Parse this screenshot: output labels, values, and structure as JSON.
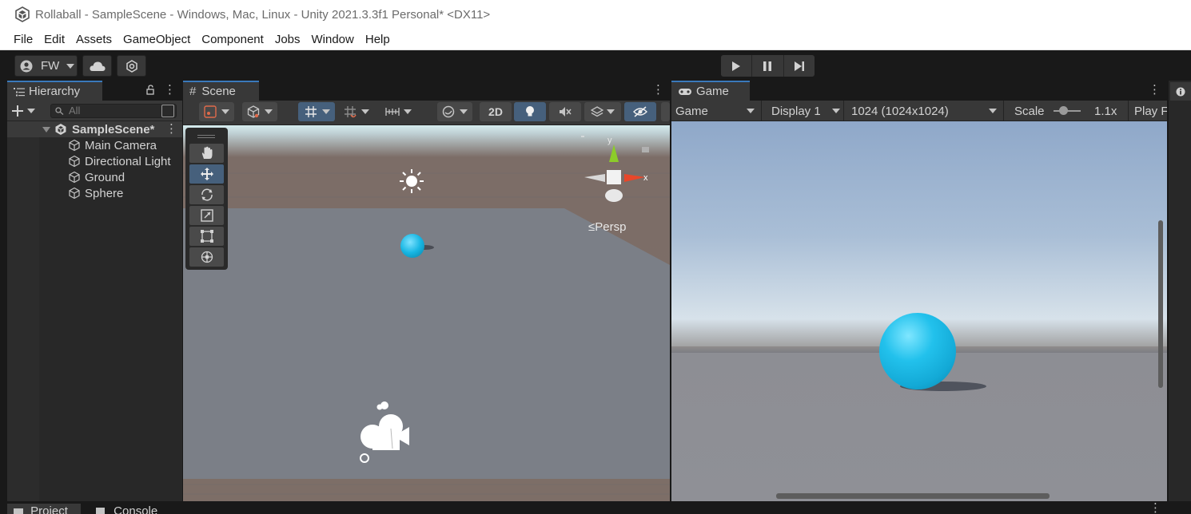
{
  "window": {
    "title": "Rollaball - SampleScene - Windows, Mac, Linux - Unity 2021.3.3f1 Personal* <DX11>"
  },
  "menu": [
    "File",
    "Edit",
    "Assets",
    "GameObject",
    "Component",
    "Jobs",
    "Window",
    "Help"
  ],
  "toolbar": {
    "account_label": "FW",
    "play_icon": "play-icon",
    "pause_icon": "pause-icon",
    "step_icon": "step-icon"
  },
  "hierarchy": {
    "tab_label": "Hierarchy",
    "search_placeholder": "All",
    "scene_name": "SampleScene*",
    "items": [
      "Main Camera",
      "Directional Light",
      "Ground",
      "Sphere"
    ]
  },
  "scene": {
    "tab_label": "Scene",
    "mode_2d_label": "2D",
    "persp_label": "≤Persp",
    "gizmo_axis_x": "x",
    "gizmo_axis_y": "y"
  },
  "game": {
    "tab_label": "Game",
    "view_dropdown": "Game",
    "display_dropdown": "Display 1",
    "resolution_dropdown": "1024 (1024x1024)",
    "scale_label": "Scale",
    "scale_value": "1.1x",
    "play_focus_label": "Play F"
  },
  "bottom_tabs": [
    "Project",
    "Console"
  ],
  "colors": {
    "accent": "#3a79bb",
    "sphere": "#17b6e3",
    "panel_bg": "#282828",
    "toolbar_bg": "#383838"
  }
}
